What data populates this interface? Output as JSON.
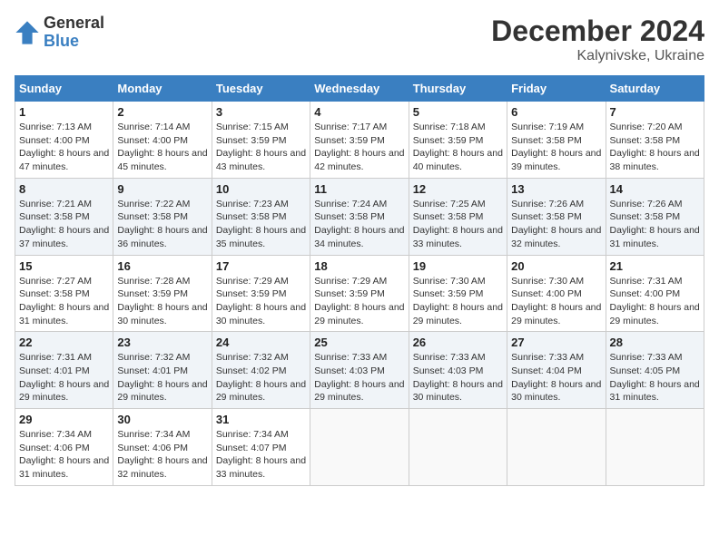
{
  "logo": {
    "general": "General",
    "blue": "Blue"
  },
  "title": "December 2024",
  "location": "Kalynivske, Ukraine",
  "weekdays": [
    "Sunday",
    "Monday",
    "Tuesday",
    "Wednesday",
    "Thursday",
    "Friday",
    "Saturday"
  ],
  "weeks": [
    [
      {
        "day": "1",
        "sunrise": "7:13 AM",
        "sunset": "4:00 PM",
        "daylight": "8 hours and 47 minutes."
      },
      {
        "day": "2",
        "sunrise": "7:14 AM",
        "sunset": "4:00 PM",
        "daylight": "8 hours and 45 minutes."
      },
      {
        "day": "3",
        "sunrise": "7:15 AM",
        "sunset": "3:59 PM",
        "daylight": "8 hours and 43 minutes."
      },
      {
        "day": "4",
        "sunrise": "7:17 AM",
        "sunset": "3:59 PM",
        "daylight": "8 hours and 42 minutes."
      },
      {
        "day": "5",
        "sunrise": "7:18 AM",
        "sunset": "3:59 PM",
        "daylight": "8 hours and 40 minutes."
      },
      {
        "day": "6",
        "sunrise": "7:19 AM",
        "sunset": "3:58 PM",
        "daylight": "8 hours and 39 minutes."
      },
      {
        "day": "7",
        "sunrise": "7:20 AM",
        "sunset": "3:58 PM",
        "daylight": "8 hours and 38 minutes."
      }
    ],
    [
      {
        "day": "8",
        "sunrise": "7:21 AM",
        "sunset": "3:58 PM",
        "daylight": "8 hours and 37 minutes."
      },
      {
        "day": "9",
        "sunrise": "7:22 AM",
        "sunset": "3:58 PM",
        "daylight": "8 hours and 36 minutes."
      },
      {
        "day": "10",
        "sunrise": "7:23 AM",
        "sunset": "3:58 PM",
        "daylight": "8 hours and 35 minutes."
      },
      {
        "day": "11",
        "sunrise": "7:24 AM",
        "sunset": "3:58 PM",
        "daylight": "8 hours and 34 minutes."
      },
      {
        "day": "12",
        "sunrise": "7:25 AM",
        "sunset": "3:58 PM",
        "daylight": "8 hours and 33 minutes."
      },
      {
        "day": "13",
        "sunrise": "7:26 AM",
        "sunset": "3:58 PM",
        "daylight": "8 hours and 32 minutes."
      },
      {
        "day": "14",
        "sunrise": "7:26 AM",
        "sunset": "3:58 PM",
        "daylight": "8 hours and 31 minutes."
      }
    ],
    [
      {
        "day": "15",
        "sunrise": "7:27 AM",
        "sunset": "3:58 PM",
        "daylight": "8 hours and 31 minutes."
      },
      {
        "day": "16",
        "sunrise": "7:28 AM",
        "sunset": "3:59 PM",
        "daylight": "8 hours and 30 minutes."
      },
      {
        "day": "17",
        "sunrise": "7:29 AM",
        "sunset": "3:59 PM",
        "daylight": "8 hours and 30 minutes."
      },
      {
        "day": "18",
        "sunrise": "7:29 AM",
        "sunset": "3:59 PM",
        "daylight": "8 hours and 29 minutes."
      },
      {
        "day": "19",
        "sunrise": "7:30 AM",
        "sunset": "3:59 PM",
        "daylight": "8 hours and 29 minutes."
      },
      {
        "day": "20",
        "sunrise": "7:30 AM",
        "sunset": "4:00 PM",
        "daylight": "8 hours and 29 minutes."
      },
      {
        "day": "21",
        "sunrise": "7:31 AM",
        "sunset": "4:00 PM",
        "daylight": "8 hours and 29 minutes."
      }
    ],
    [
      {
        "day": "22",
        "sunrise": "7:31 AM",
        "sunset": "4:01 PM",
        "daylight": "8 hours and 29 minutes."
      },
      {
        "day": "23",
        "sunrise": "7:32 AM",
        "sunset": "4:01 PM",
        "daylight": "8 hours and 29 minutes."
      },
      {
        "day": "24",
        "sunrise": "7:32 AM",
        "sunset": "4:02 PM",
        "daylight": "8 hours and 29 minutes."
      },
      {
        "day": "25",
        "sunrise": "7:33 AM",
        "sunset": "4:03 PM",
        "daylight": "8 hours and 29 minutes."
      },
      {
        "day": "26",
        "sunrise": "7:33 AM",
        "sunset": "4:03 PM",
        "daylight": "8 hours and 30 minutes."
      },
      {
        "day": "27",
        "sunrise": "7:33 AM",
        "sunset": "4:04 PM",
        "daylight": "8 hours and 30 minutes."
      },
      {
        "day": "28",
        "sunrise": "7:33 AM",
        "sunset": "4:05 PM",
        "daylight": "8 hours and 31 minutes."
      }
    ],
    [
      {
        "day": "29",
        "sunrise": "7:34 AM",
        "sunset": "4:06 PM",
        "daylight": "8 hours and 31 minutes."
      },
      {
        "day": "30",
        "sunrise": "7:34 AM",
        "sunset": "4:06 PM",
        "daylight": "8 hours and 32 minutes."
      },
      {
        "day": "31",
        "sunrise": "7:34 AM",
        "sunset": "4:07 PM",
        "daylight": "8 hours and 33 minutes."
      },
      null,
      null,
      null,
      null
    ]
  ]
}
